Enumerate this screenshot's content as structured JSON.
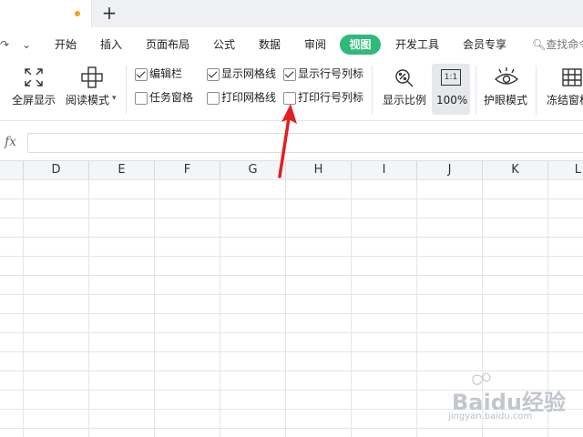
{
  "tab_bar": {
    "new_tab_symbol": "+"
  },
  "menu": {
    "items": [
      "开始",
      "插入",
      "页面布局",
      "公式",
      "数据",
      "审阅",
      "视图",
      "开发工具",
      "会员专享"
    ],
    "active": "视图",
    "search_placeholder": "查找命令"
  },
  "ribbon": {
    "fullscreen_label": "全屏显示",
    "reading_mode_label": "阅读模式",
    "checkboxes": [
      {
        "label": "编辑栏",
        "checked": true
      },
      {
        "label": "任务窗格",
        "checked": false
      },
      {
        "label": "显示网格线",
        "checked": true
      },
      {
        "label": "打印网格线",
        "checked": false
      },
      {
        "label": "显示行号列标",
        "checked": true
      },
      {
        "label": "打印行号列标",
        "checked": false
      }
    ],
    "zoom_ratio_label": "显示比例",
    "zoom_value": "100%",
    "zoom_icon_text": "1:1",
    "eye_protection_label": "护眼模式",
    "freeze_panes_label": "冻结窗格"
  },
  "formula_bar": {
    "fx_label": "fx",
    "value": ""
  },
  "columns": [
    "D",
    "E",
    "F",
    "G",
    "H",
    "I",
    "J",
    "K",
    "L"
  ],
  "watermark": {
    "brand": "Baidu经验",
    "url": "jingyan.baidu.com"
  },
  "colors": {
    "accent": "#2fb97a",
    "arrow": "#e02020",
    "tab_dot": "#f2a31a"
  }
}
